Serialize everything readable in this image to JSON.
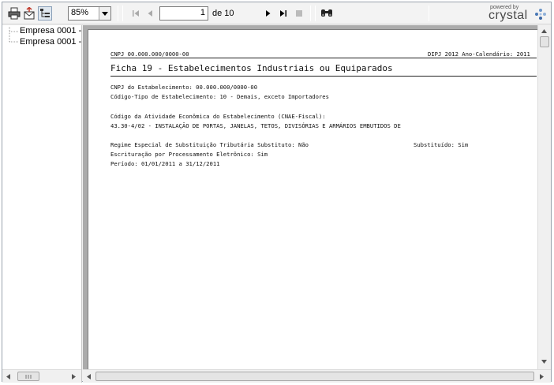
{
  "toolbar": {
    "zoom": "85%",
    "page_current": "1",
    "page_total": "de 10"
  },
  "brand": {
    "small": "powered by",
    "big": "crystal"
  },
  "tree": {
    "items": [
      "Empresa 0001 -",
      "Empresa 0001 -"
    ]
  },
  "report": {
    "header_left": "CNPJ 00.000.000/0000-00",
    "header_right": "DIPJ 2012  Ano-Calendário: 2011",
    "title": "Ficha 19 - Estabelecimentos Industriais ou Equiparados",
    "cnpj_estab": "CNPJ do Estabelecimento: 00.000.000/0000-00",
    "codigo_tipo": "Código-Tipo de Estabelecimento: 10 - Demais, exceto Importadores",
    "cnae_label": "Código da Atividade Econômica do Estabelecimento (CNAE-Fiscal):",
    "cnae_value": "43.30-4/02 - INSTALAÇÃO DE PORTAS, JANELAS, TETOS, DIVISÓRIAS E ARMÁRIOS EMBUTIDOS DE",
    "regime": "Regime Especial de Substituição Tributária Substituto: Não",
    "substituido": "Substituído: Sim",
    "escrituracao": "Escrituração por Processamento Eletrônico: Sim",
    "periodo": "Período: 01/01/2011 a 31/12/2011"
  },
  "colors": {
    "preview_bg": "#ababab",
    "page_bg": "#ffffff"
  },
  "icons": [
    "print-icon",
    "export-icon",
    "toggle-tree-icon",
    "first-page-icon",
    "prev-page-icon",
    "next-page-icon",
    "last-page-icon",
    "stop-icon",
    "search-icon",
    "crystal-logo-icon"
  ]
}
